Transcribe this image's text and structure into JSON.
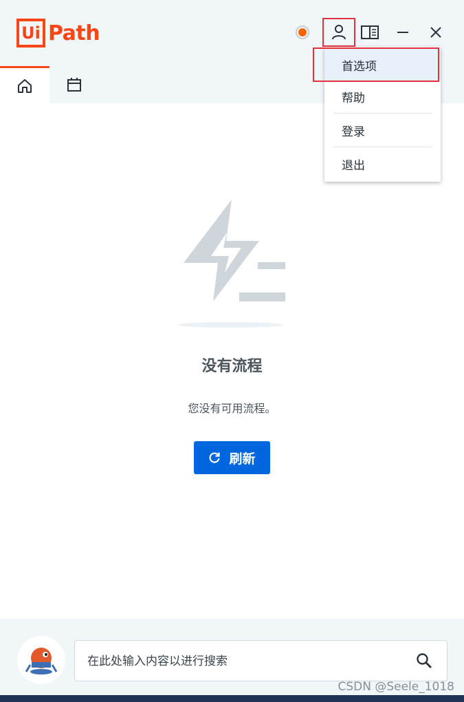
{
  "header": {
    "logo_ui": "Ui",
    "logo_path": "Path",
    "status_color": "#fa6400"
  },
  "icons": {
    "user": "user-icon",
    "panel": "panel-icon",
    "minimize": "minimize-icon",
    "close": "close-icon",
    "home": "home-icon",
    "calendar": "calendar-icon",
    "refresh": "refresh-icon",
    "search": "search-icon"
  },
  "menu": {
    "items": [
      {
        "label": "首选项"
      },
      {
        "label": "帮助"
      },
      {
        "label": "登录"
      },
      {
        "label": "退出"
      }
    ]
  },
  "main": {
    "empty_title": "没有流程",
    "empty_desc": "您没有可用流程。",
    "refresh_label": "刷新"
  },
  "search": {
    "placeholder": "在此处输入内容以进行搜索",
    "value": ""
  },
  "watermark": "CSDN @Seele_1018",
  "colors": {
    "brand": "#fa4616",
    "primary": "#0067df",
    "highlight": "#e2313c"
  }
}
